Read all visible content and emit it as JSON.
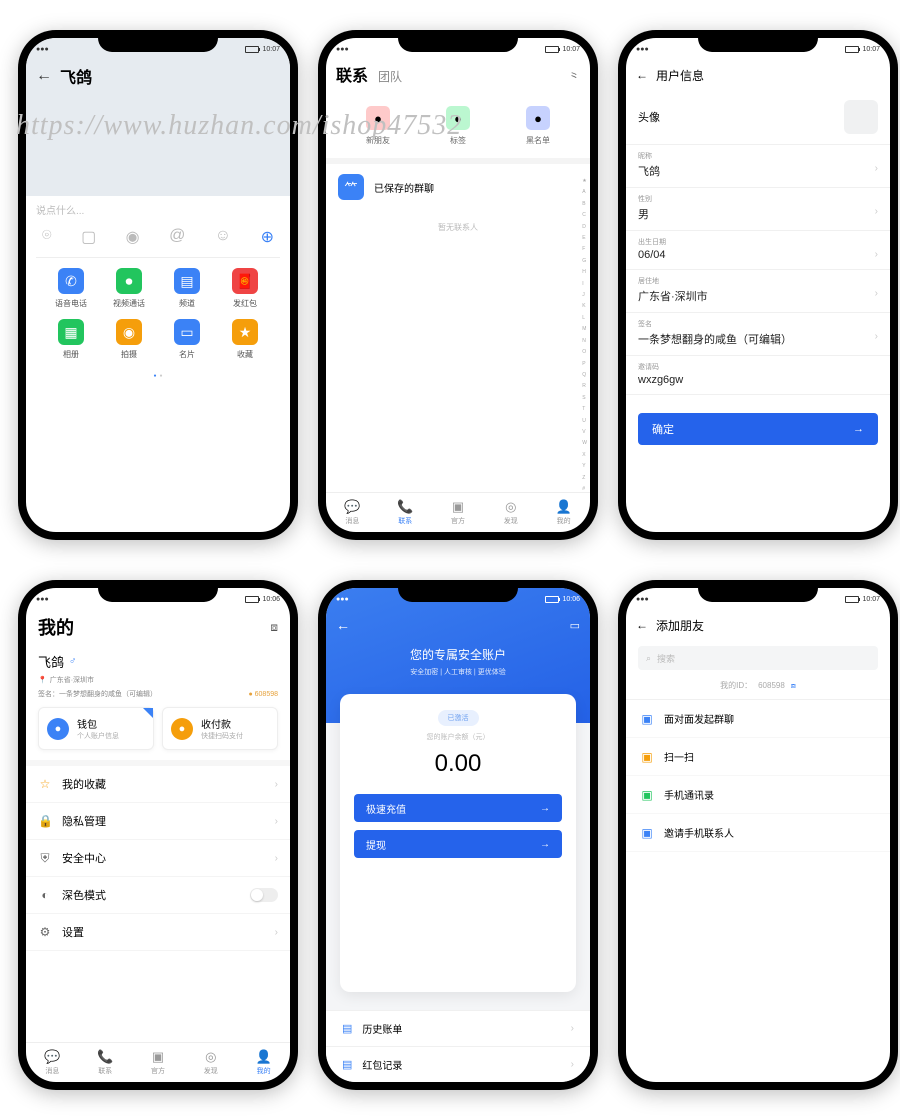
{
  "watermark": "https://www.huzhan.com/ishop47532",
  "status_time": "10:07",
  "status_time_alt": "10:06",
  "phone1": {
    "title": "飞鸽",
    "placeholder": "说点什么...",
    "grid": [
      {
        "label": "语音电话",
        "color": "#3b82f6",
        "icon": "phone"
      },
      {
        "label": "视频通话",
        "color": "#22c55e",
        "icon": "video"
      },
      {
        "label": "频道",
        "color": "#3b82f6",
        "icon": "channel"
      },
      {
        "label": "发红包",
        "color": "#ef4444",
        "icon": "redpacket"
      },
      {
        "label": "相册",
        "color": "#22c55e",
        "icon": "album"
      },
      {
        "label": "拍摄",
        "color": "#f59e0b",
        "icon": "camera"
      },
      {
        "label": "名片",
        "color": "#3b82f6",
        "icon": "card"
      },
      {
        "label": "收藏",
        "color": "#f59e0b",
        "icon": "favorite"
      }
    ]
  },
  "phone2": {
    "tab1": "联系",
    "tab2": "团队",
    "quick": [
      {
        "label": "新朋友",
        "color": "#fecaca"
      },
      {
        "label": "标签",
        "color": "#bbf7d0"
      },
      {
        "label": "黑名单",
        "color": "#c7d2fe"
      }
    ],
    "saved_groups": "已保存的群聊",
    "empty": "暂无联系人",
    "index": [
      "★",
      "A",
      "B",
      "C",
      "D",
      "E",
      "F",
      "G",
      "H",
      "I",
      "J",
      "K",
      "L",
      "M",
      "N",
      "O",
      "P",
      "Q",
      "R",
      "S",
      "T",
      "U",
      "V",
      "W",
      "X",
      "Y",
      "Z",
      "#"
    ],
    "nav": [
      {
        "label": "消息"
      },
      {
        "label": "联系"
      },
      {
        "label": "官方"
      },
      {
        "label": "发现"
      },
      {
        "label": "我的"
      }
    ],
    "nav_active": 1
  },
  "phone3": {
    "title": "用户信息",
    "avatar_label": "头像",
    "fields": [
      {
        "k": "昵称",
        "v": "飞鸽",
        "chev": true
      },
      {
        "k": "性别",
        "v": "男",
        "chev": true
      },
      {
        "k": "出生日期",
        "v": "06/04",
        "chev": true
      },
      {
        "k": "居住地",
        "v": "广东省·深圳市",
        "chev": true
      },
      {
        "k": "签名",
        "v": "一条梦想翻身的咸鱼（可编辑）",
        "chev": true
      },
      {
        "k": "邀请码",
        "v": "wxzg6gw",
        "chev": false
      }
    ],
    "confirm": "确定"
  },
  "phone4": {
    "title": "我的",
    "name": "飞鸽",
    "location": "广东省·深圳市",
    "signature_label": "签名：",
    "signature": "一条梦想翻身的咸鱼（可编辑）",
    "coin": "608598",
    "cards": [
      {
        "title": "钱包",
        "sub": "个人账户信息",
        "color": "#3b82f6"
      },
      {
        "title": "收付款",
        "sub": "快捷扫码支付",
        "color": "#f59e0b"
      }
    ],
    "list": [
      {
        "label": "我的收藏",
        "icon": "star",
        "color": "#f59e0b",
        "type": "chev"
      },
      {
        "label": "隐私管理",
        "icon": "lock",
        "color": "#666",
        "type": "chev"
      },
      {
        "label": "安全中心",
        "icon": "shield",
        "color": "#666",
        "type": "chev"
      },
      {
        "label": "深色模式",
        "icon": "moon",
        "color": "#666",
        "type": "toggle"
      },
      {
        "label": "设置",
        "icon": "gear",
        "color": "#666",
        "type": "chev"
      }
    ],
    "nav_active": 4
  },
  "phone5": {
    "title": "您的专属安全账户",
    "subtitle": "安全加密 | 人工审核 | 更优体验",
    "badge": "已激活",
    "balance_label": "您的账户余额（元）",
    "balance": "0.00",
    "actions": [
      "极速充值",
      "提现"
    ],
    "bottom": [
      "历史账单",
      "红包记录"
    ]
  },
  "phone6": {
    "title": "添加朋友",
    "search_placeholder": "搜索",
    "my_id_label": "我的ID：",
    "my_id": "608598",
    "list": [
      {
        "label": "面对面发起群聊",
        "color": "#3b82f6"
      },
      {
        "label": "扫一扫",
        "color": "#f59e0b"
      },
      {
        "label": "手机通讯录",
        "color": "#22c55e"
      },
      {
        "label": "邀请手机联系人",
        "color": "#3b82f6"
      }
    ]
  }
}
